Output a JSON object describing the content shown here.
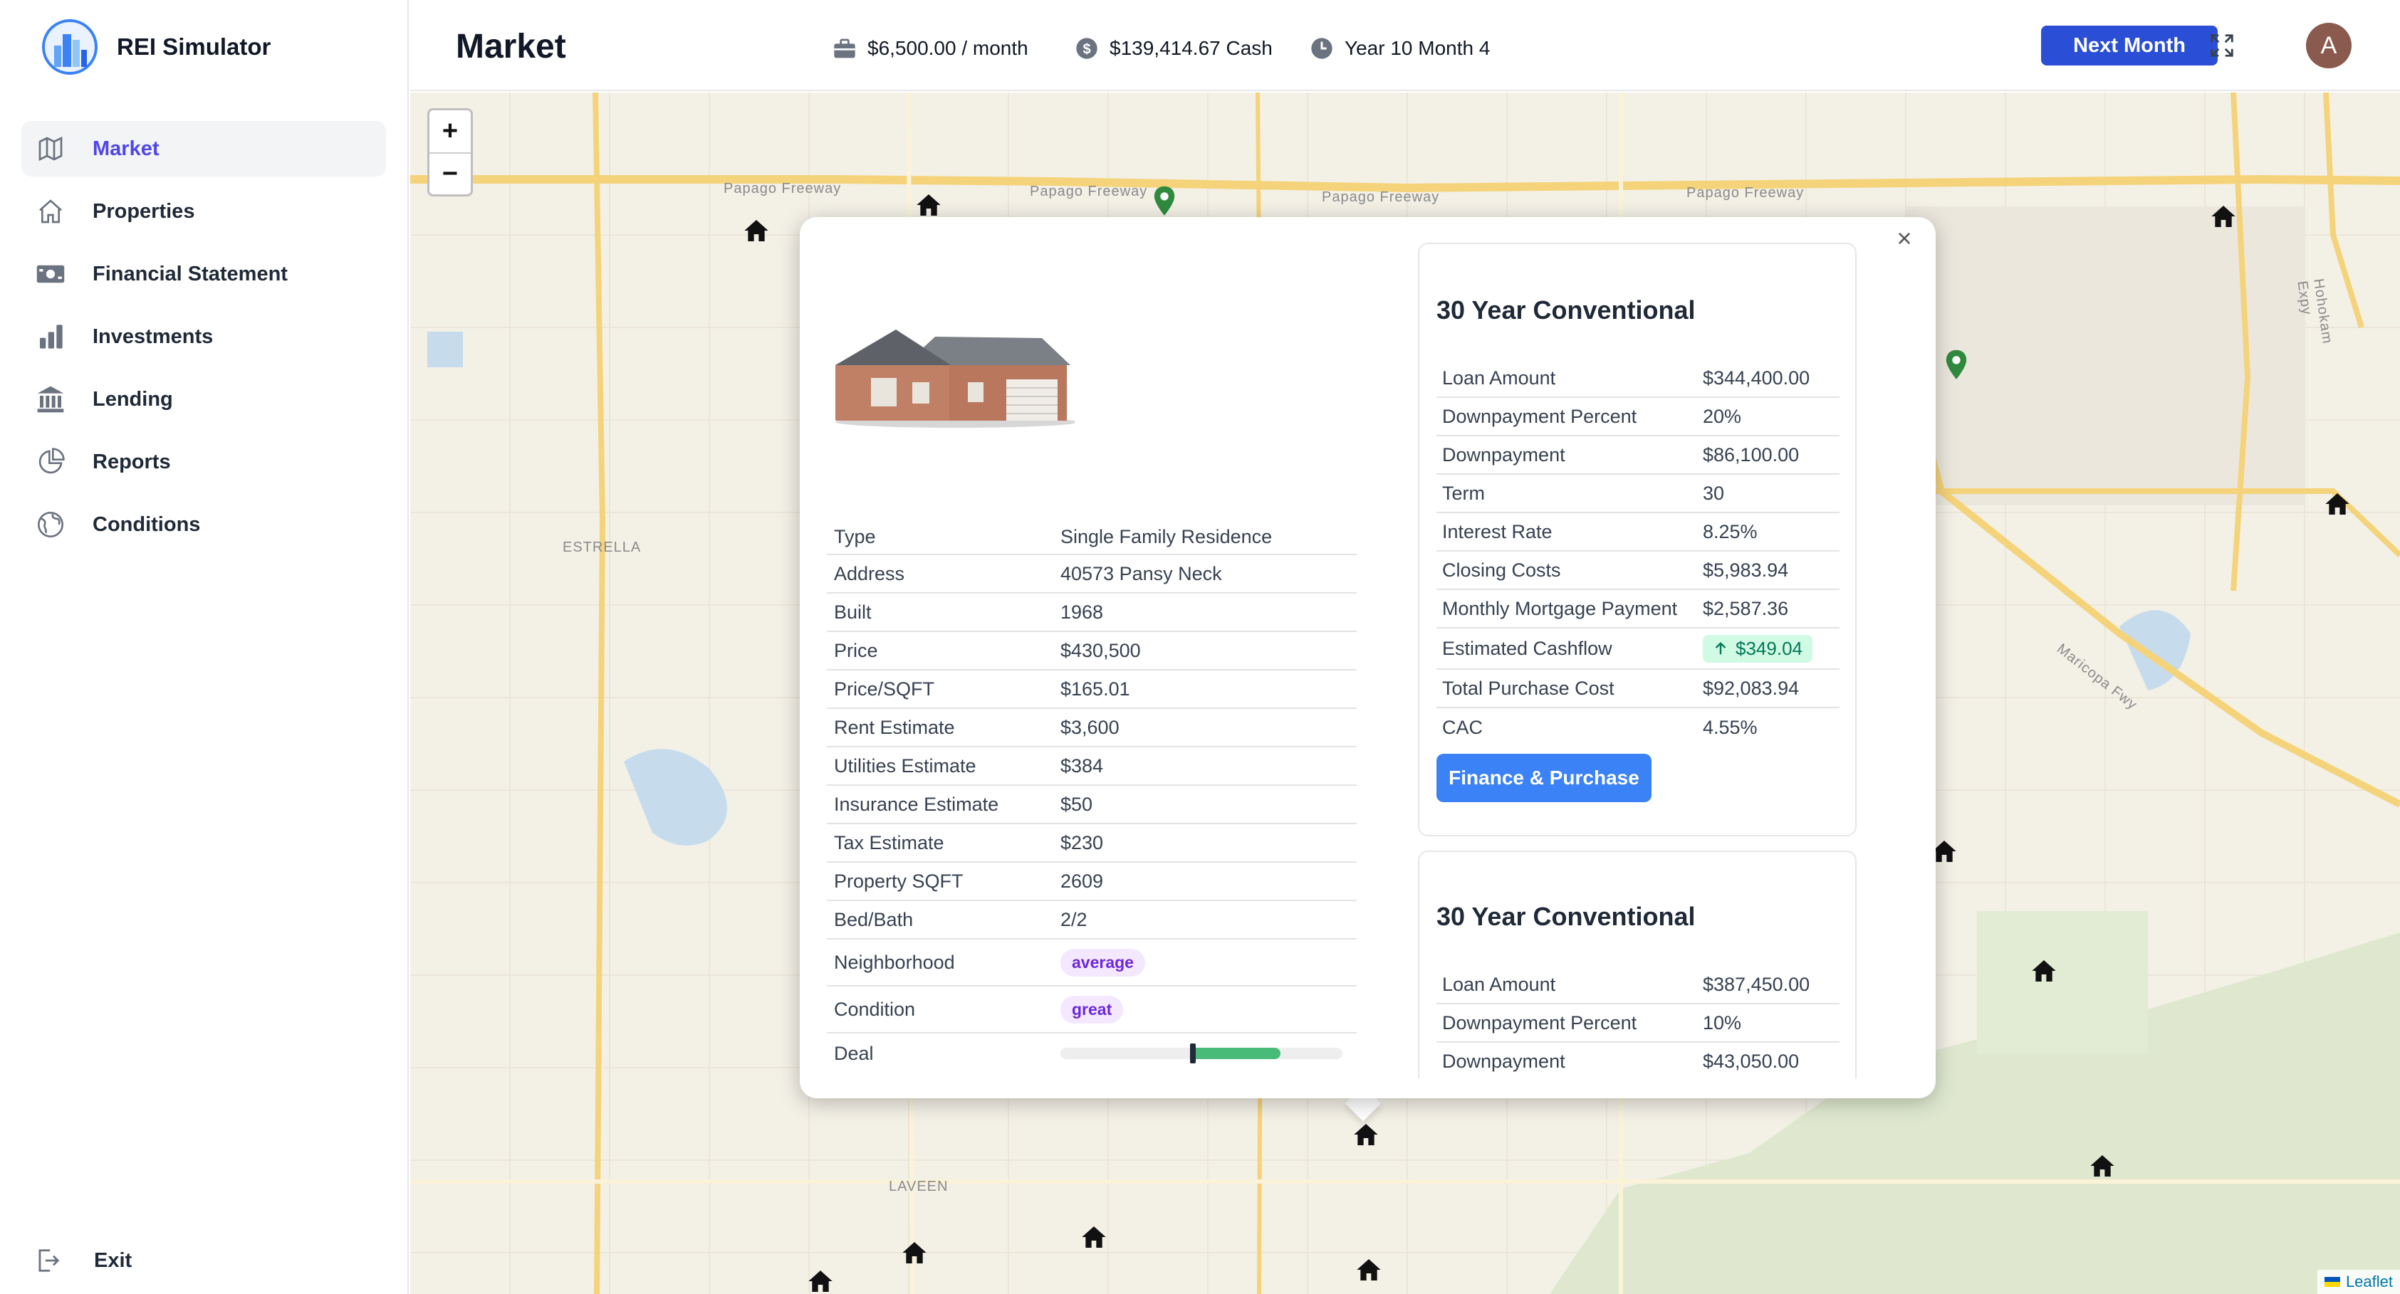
{
  "app": {
    "name": "REI Simulator"
  },
  "sidebar": {
    "items": [
      {
        "label": "Market",
        "icon": "map-icon",
        "active": true
      },
      {
        "label": "Properties",
        "icon": "home-icon"
      },
      {
        "label": "Financial Statement",
        "icon": "cash-icon"
      },
      {
        "label": "Investments",
        "icon": "bar-chart-icon"
      },
      {
        "label": "Lending",
        "icon": "bank-icon"
      },
      {
        "label": "Reports",
        "icon": "pie-chart-icon"
      },
      {
        "label": "Conditions",
        "icon": "globe-icon"
      }
    ],
    "exit_label": "Exit"
  },
  "header": {
    "title": "Market",
    "income": "$6,500.00 / month",
    "cash": "$139,414.67 Cash",
    "date": "Year 10 Month 4",
    "next_label": "Next Month",
    "avatar_initial": "A"
  },
  "map": {
    "zoom_in": "+",
    "zoom_out": "−",
    "attribution": "Leaflet",
    "labels": {
      "freeway1": "Papago Freeway",
      "freeway2": "Papago Freeway",
      "freeway3": "Papago Freeway",
      "freeway4": "Papago Freeway",
      "estrella": "ESTRELLA",
      "laveen": "LAVEEN",
      "maricopa": "Maricopa Fwy",
      "hohokam": "Hohokam Expy"
    }
  },
  "property": {
    "rows": [
      {
        "key": "Type",
        "value": "Single Family Residence"
      },
      {
        "key": "Address",
        "value": "40573 Pansy Neck"
      },
      {
        "key": "Built",
        "value": "1968"
      },
      {
        "key": "Price",
        "value": "$430,500"
      },
      {
        "key": "Price/SQFT",
        "value": "$165.01"
      },
      {
        "key": "Rent Estimate",
        "value": "$3,600"
      },
      {
        "key": "Utilities Estimate",
        "value": "$384"
      },
      {
        "key": "Insurance Estimate",
        "value": "$50"
      },
      {
        "key": "Tax Estimate",
        "value": "$230"
      },
      {
        "key": "Property SQFT",
        "value": "2609"
      },
      {
        "key": "Bed/Bath",
        "value": "2/2"
      }
    ],
    "neighborhood_label": "Neighborhood",
    "neighborhood": "average",
    "condition_label": "Condition",
    "condition": "great",
    "deal_label": "Deal",
    "deal": {
      "fill_start": 0.46,
      "fill_end": 0.78,
      "marker": 0.46
    }
  },
  "loans": [
    {
      "title": "30 Year Conventional",
      "rows": [
        {
          "key": "Loan Amount",
          "value": "$344,400.00"
        },
        {
          "key": "Downpayment Percent",
          "value": "20%"
        },
        {
          "key": "Downpayment",
          "value": "$86,100.00"
        },
        {
          "key": "Term",
          "value": "30"
        },
        {
          "key": "Interest Rate",
          "value": "8.25%"
        },
        {
          "key": "Closing Costs",
          "value": "$5,983.94"
        },
        {
          "key": "Monthly Mortgage Payment",
          "value": "$2,587.36"
        }
      ],
      "cashflow_label": "Estimated Cashflow",
      "cashflow": "$349.04",
      "rows2": [
        {
          "key": "Total Purchase Cost",
          "value": "$92,083.94"
        },
        {
          "key": "CAC",
          "value": "4.55%"
        }
      ],
      "button": "Finance & Purchase"
    },
    {
      "title": "30 Year Conventional",
      "rows": [
        {
          "key": "Loan Amount",
          "value": "$387,450.00"
        },
        {
          "key": "Downpayment Percent",
          "value": "10%"
        },
        {
          "key": "Downpayment",
          "value": "$43,050.00"
        }
      ]
    }
  ],
  "colors": {
    "accent": "#2a4fd6",
    "active_nav": "#4f46e5",
    "finance_button": "#3b82f6",
    "cashflow_bg": "#d1fae5",
    "badge_bg": "#f3e8ff",
    "deal_fill": "#48bb78",
    "map_bg": "#f3f0e6",
    "freeway": "#f5d37a"
  }
}
